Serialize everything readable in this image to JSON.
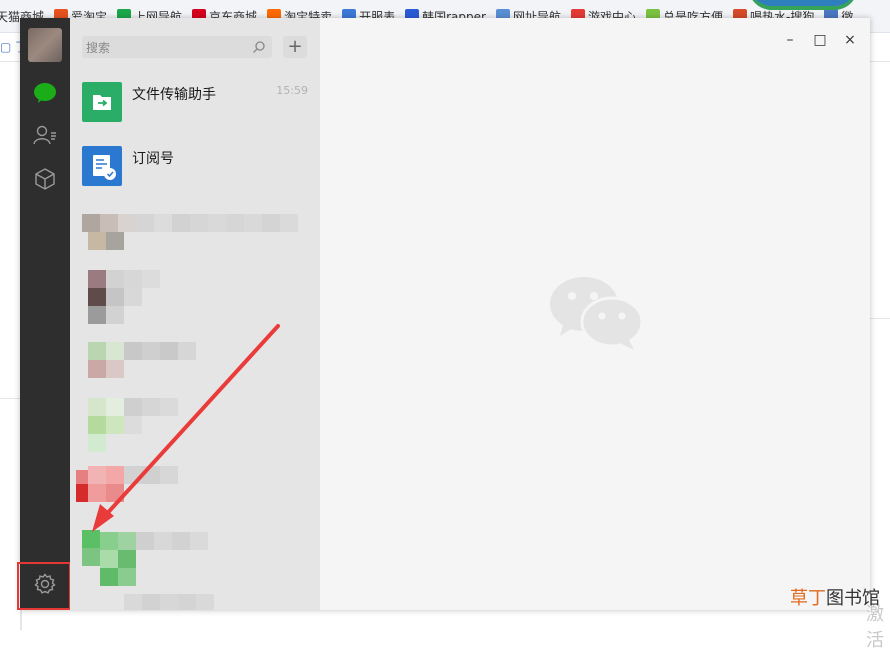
{
  "browser": {
    "bookmarks": [
      {
        "label": "天猫商城",
        "color": "#ffffff"
      },
      {
        "label": "爱淘宝",
        "color": "#e8531f"
      },
      {
        "label": "上网导航",
        "color": "#1aa84a"
      },
      {
        "label": "京东商城",
        "color": "#d6001c"
      },
      {
        "label": "淘宝特卖",
        "color": "#ff6a00"
      },
      {
        "label": "开服表",
        "color": "#3c78d8"
      },
      {
        "label": "韩国rapper",
        "color": "#2a5bd7"
      },
      {
        "label": "网址导航",
        "color": "#5a8fd6"
      },
      {
        "label": "游戏中心",
        "color": "#e53935"
      },
      {
        "label": "总是吃方便",
        "color": "#7cc242"
      },
      {
        "label": "喝热水-搜狗",
        "color": "#d64b2a"
      },
      {
        "label": "微",
        "color": "#4a78c2"
      }
    ],
    "tab_fragment": "▢ 了"
  },
  "wechat": {
    "search_placeholder": "搜索",
    "add_label": "+",
    "chats": [
      {
        "name": "文件传输助手",
        "time": "15:59",
        "icon": "file-transfer-icon"
      },
      {
        "name": "订阅号",
        "time": "",
        "icon": "subscription-icon"
      }
    ],
    "window_controls": {
      "minimize": "–",
      "maximize": "□",
      "close": "×"
    },
    "nav_icons": [
      "chat-icon",
      "contacts-icon",
      "favorites-icon",
      "settings-icon"
    ],
    "accent": "#1aad19",
    "highlight": "#e53935"
  },
  "watermark": {
    "part1": "草丁",
    "part2": "图书馆",
    "bg_text": "激活"
  }
}
